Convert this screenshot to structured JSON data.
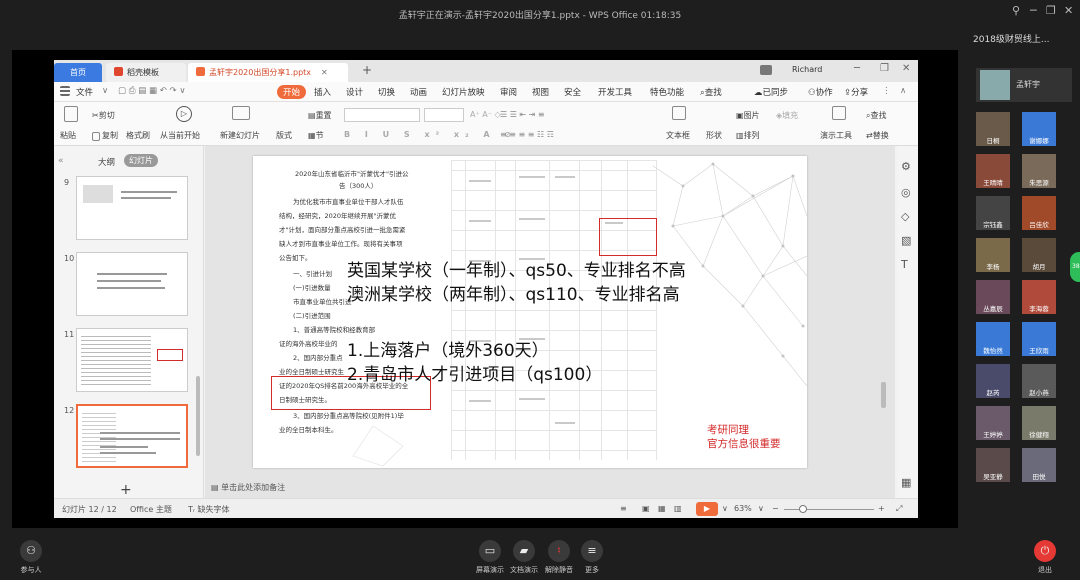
{
  "window": {
    "title": "孟轩宇正在演示-孟轩宇2020出国分享1.pptx - WPS Office 01:18:35"
  },
  "meeting": {
    "sidebar_title": "2018级财贸线上...",
    "host_name": "孟轩宇",
    "participants": [
      "日桐",
      "谢娜娜",
      "王晴晴",
      "朱思源",
      "宗钰鑫",
      "吕佳欣",
      "李杨",
      "胡月",
      "丛嘉辰",
      "李海蓉",
      "魏怡然",
      "王欣雨",
      "赵芮",
      "赵小燕",
      "王婷婷",
      "徐健翔",
      "吴亚静",
      "田悦"
    ],
    "side_badge": "38",
    "toolbar": {
      "participants": "参与人",
      "share_screen": "屏幕演示",
      "share_doc": "文档演示",
      "unmute": "解除静音",
      "more": "更多",
      "leave": "退出"
    }
  },
  "wps": {
    "tabs": {
      "home": "首页",
      "template": "稻壳模板",
      "file": "孟轩宇2020出国分享1.pptx"
    },
    "user": "Richard",
    "menu": [
      "文件",
      "开始",
      "插入",
      "设计",
      "切换",
      "动画",
      "幻灯片放映",
      "审阅",
      "视图",
      "安全",
      "开发工具",
      "特色功能",
      "查找"
    ],
    "menu_right": [
      "已同步",
      "协作",
      "分享"
    ],
    "ribbon": {
      "paste": "粘贴",
      "cut": "剪切",
      "copy": "复制",
      "format_painter": "格式刷",
      "from_current": "从当前开始",
      "new_slide": "新建幻灯片",
      "layout": "版式",
      "section": "节",
      "reset": "重置",
      "textbox": "文本框",
      "shape": "形状",
      "picture": "图片",
      "arrange": "排列",
      "fill": "填充",
      "slide_tools": "演示工具",
      "find": "查找",
      "replace": "替换"
    },
    "panel_tabs": {
      "outline": "大纲",
      "slides": "幻灯片"
    },
    "thumbs": [
      "9",
      "10",
      "11",
      "12"
    ],
    "slide": {
      "doc_lines": [
        "2020年山东省临沂市\"沂蒙优才\"引进公",
        "告（300人）",
        "为优化我市市直事业单位干部人才队伍",
        "结构，经研究，2020年继续开展\"沂蒙优",
        "才\"计划，面向部分重点高校引进一批急需紧",
        "缺人才到市直事业单位工作。现将有关事项",
        "公告如下。",
        "一、引进计划",
        "(一)引进数量",
        "市直事业单位共引进",
        "(二)引进范围",
        "1、普通高等院校和经教育部",
        "证的海外高校毕业的",
        "2、国内部分重点",
        "业的全日制硕士研究生",
        "证的2020年QS排名前200海外高校毕业的全",
        "日制硕士研究生。",
        "3、国内部分重点高等院校(见附件1)毕",
        "业的全日制本科生。"
      ],
      "big_lines": [
        "英国某学校（一年制）、qs50、专业排名不高",
        "澳洲某学校（两年制）、qs110、专业排名高",
        "1.上海落户（境外360天）",
        "2.青岛市人才引进项目（qs100）"
      ],
      "red_note": [
        "考研同理",
        "官方信息很重要"
      ]
    },
    "notes_placeholder": "单击此处添加备注",
    "status": {
      "slide_pos": "幻灯片 12 / 12",
      "theme": "Office 主题",
      "missing_font": "缺失字体",
      "zoom": "63%"
    }
  }
}
